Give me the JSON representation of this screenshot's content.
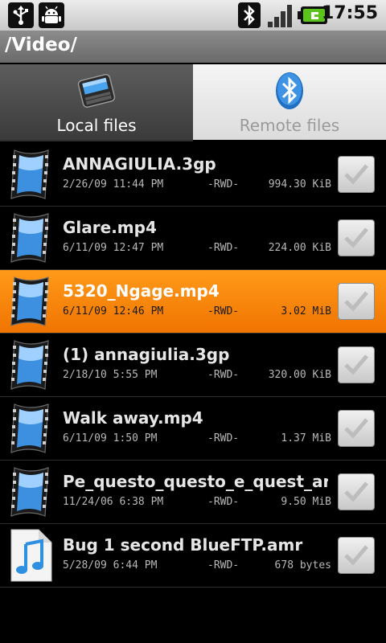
{
  "status_bar": {
    "time": "17:55",
    "left_icons": [
      "usb-icon",
      "android-debug-icon"
    ],
    "right_icons": [
      "bluetooth-icon",
      "signal-icon",
      "battery-icon"
    ]
  },
  "path": "/Video/",
  "tabs": [
    {
      "label": "Local files",
      "icon": "device-icon",
      "active": true
    },
    {
      "label": "Remote files",
      "icon": "bluetooth-icon",
      "active": false
    }
  ],
  "files": [
    {
      "name": "ANNAGIULIA.3gp",
      "date": "2/26/09 11:44 PM",
      "perm": "-RWD-",
      "size": "994.30 KiB",
      "type": "video",
      "selected": false
    },
    {
      "name": "Glare.mp4",
      "date": "6/11/09 12:47 PM",
      "perm": "-RWD-",
      "size": "224.00 KiB",
      "type": "video",
      "selected": false
    },
    {
      "name": "5320_Ngage.mp4",
      "date": "6/11/09 12:46 PM",
      "perm": "-RWD-",
      "size": "3.02 MiB",
      "type": "video",
      "selected": true
    },
    {
      "name": "(1) annagiulia.3gp",
      "date": "2/18/10 5:55 PM",
      "perm": "-RWD-",
      "size": "320.00 KiB",
      "type": "video",
      "selected": false
    },
    {
      "name": "Walk away.mp4",
      "date": "6/11/09 1:50 PM",
      "perm": "-RWD-",
      "size": "1.37 MiB",
      "type": "video",
      "selected": false
    },
    {
      "name": "Pe_questo_questo_e_quest_artro",
      "date": "11/24/06 6:38 PM",
      "perm": "-RWD-",
      "size": "9.50 MiB",
      "type": "video",
      "selected": false
    },
    {
      "name": "Bug 1 second BlueFTP.amr",
      "date": "5/28/09 6:44 PM",
      "perm": "-RWD-",
      "size": "678 bytes",
      "type": "audio",
      "selected": false
    }
  ],
  "colors": {
    "selected_row": "#f48a10",
    "accent_blue": "#2f8fe0"
  }
}
